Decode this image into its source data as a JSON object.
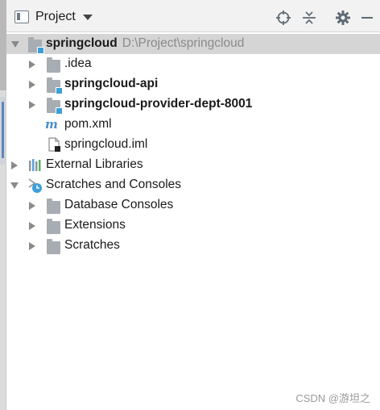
{
  "header": {
    "view_label": "Project",
    "tools": [
      "locate-icon",
      "collapse-all-icon",
      "gear-icon",
      "hide-icon"
    ]
  },
  "tree": {
    "root": {
      "name": "springcloud",
      "path": "D:\\Project\\springcloud"
    },
    "children": [
      {
        "name": ".idea",
        "bold": false
      },
      {
        "name": "springcloud-api",
        "bold": true
      },
      {
        "name": "springcloud-provider-dept-8001",
        "bold": true
      },
      {
        "name": "pom.xml",
        "bold": false
      },
      {
        "name": "springcloud.iml",
        "bold": false
      }
    ],
    "external_libraries": "External Libraries",
    "scratches_and_consoles": "Scratches and Consoles",
    "scratch_children": [
      "Database Consoles",
      "Extensions",
      "Scratches"
    ]
  },
  "watermark": "CSDN @游坦之",
  "colors": {
    "selected_row": "#d5d5d5",
    "folder": "#a7adb3",
    "module_badge": "#3b9fd8",
    "header_bg": "#f2f2f2"
  }
}
